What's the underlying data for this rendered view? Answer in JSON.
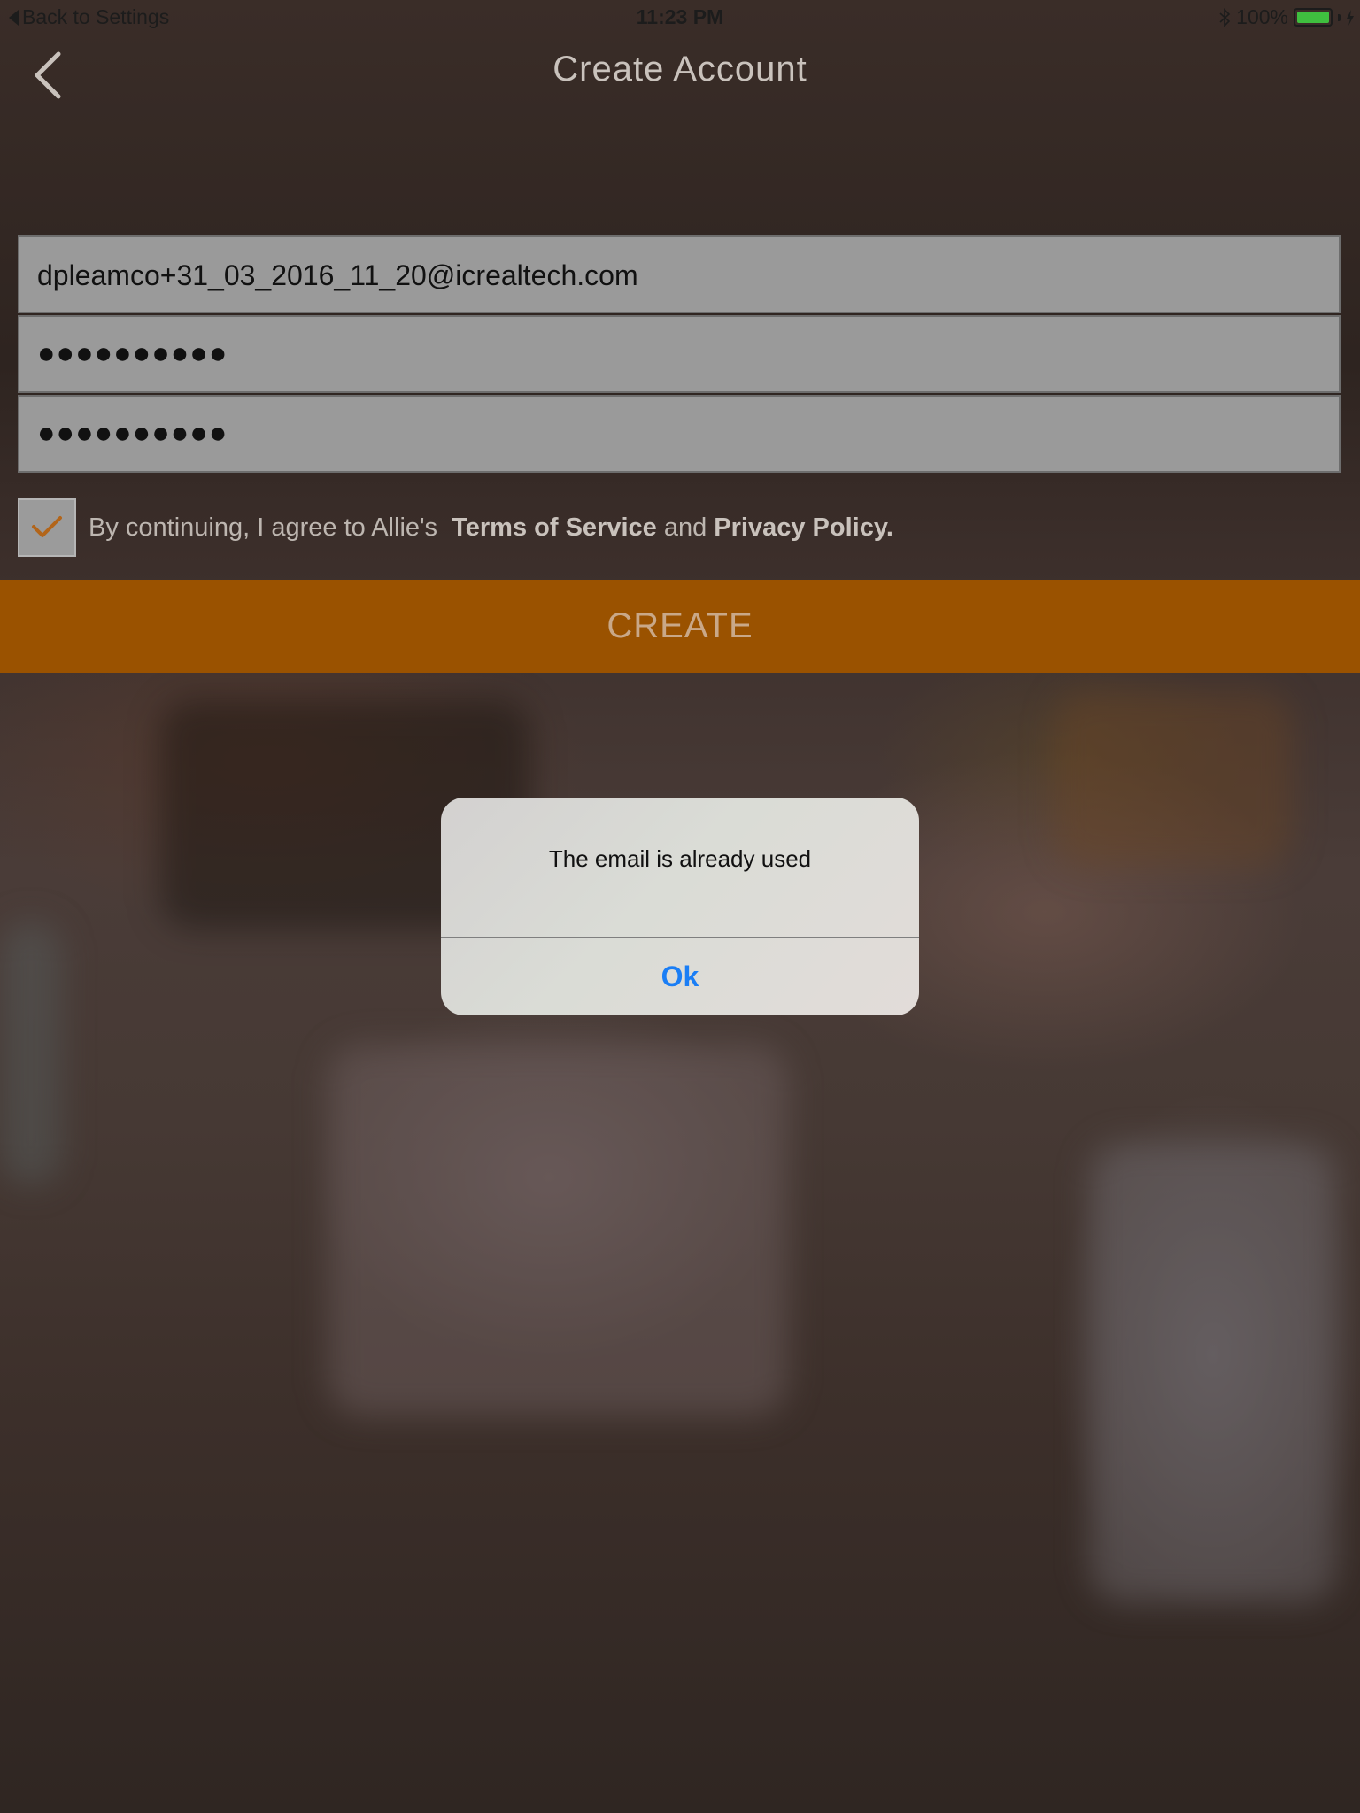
{
  "status_bar": {
    "back_label": "Back to Settings",
    "time": "11:23 PM",
    "battery_text": "100%",
    "battery_color": "#3fbf3f"
  },
  "nav": {
    "title": "Create Account",
    "back_icon": "chevron-left-icon"
  },
  "form": {
    "email_value": "dpleamco+31_03_2016_11_20@icrealtech.com",
    "password_dots": "●●●●●●●●●●",
    "confirm_dots": "●●●●●●●●●●",
    "agree_checked": true,
    "terms_prefix": "By continuing, I agree to Allie's",
    "terms_link": "Terms of Service",
    "terms_and": "and",
    "privacy_link": "Privacy Policy."
  },
  "create_button": {
    "label": "CREATE",
    "color": "#9a5200"
  },
  "alert": {
    "message": "The email is already used",
    "ok_label": "Ok",
    "ok_color": "#1a7ef5"
  }
}
